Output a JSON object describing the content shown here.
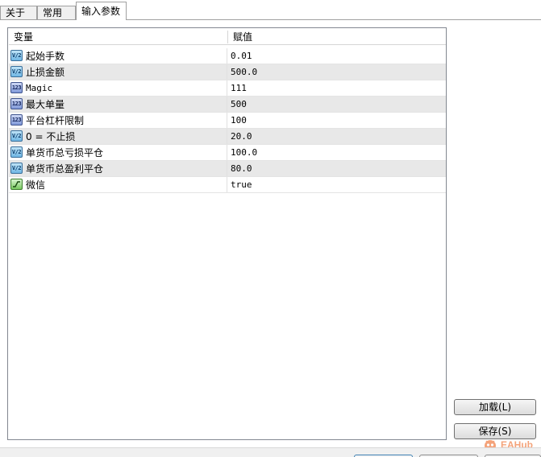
{
  "tabs": [
    {
      "label": "关于",
      "active": false
    },
    {
      "label": "常用",
      "active": false
    },
    {
      "label": "输入参数",
      "active": true
    }
  ],
  "grid": {
    "columns": {
      "name": "变量",
      "value": "赋值"
    },
    "rows": [
      {
        "type_icon": "double-type-icon",
        "icon_text": "V/2",
        "name": "起始手数",
        "value": "0.01"
      },
      {
        "type_icon": "double-type-icon",
        "icon_text": "V/2",
        "name": "止损金额",
        "value": "500.0"
      },
      {
        "type_icon": "int-type-icon",
        "icon_text": "123",
        "name": "Magic",
        "value": "111"
      },
      {
        "type_icon": "int-type-icon",
        "icon_text": "123",
        "name": "最大单量",
        "value": "500"
      },
      {
        "type_icon": "int-type-icon",
        "icon_text": "123",
        "name": "平台杠杆限制",
        "value": "100"
      },
      {
        "type_icon": "double-type-icon",
        "icon_text": "V/2",
        "name": "0 = 不止损",
        "value": "20.0"
      },
      {
        "type_icon": "double-type-icon",
        "icon_text": "V/2",
        "name": "单货币总亏损平仓",
        "value": "100.0"
      },
      {
        "type_icon": "double-type-icon",
        "icon_text": "V/2",
        "name": "单货币总盈利平仓",
        "value": "80.0"
      },
      {
        "type_icon": "bool-type-icon",
        "icon_text": "",
        "name": "微信",
        "value": "true"
      }
    ]
  },
  "buttons": {
    "load": "加载(L)",
    "save": "保存(S)"
  },
  "watermark": {
    "text": "EAHub",
    "icon": "eahub-logo-icon",
    "color": "#f4a37a"
  }
}
